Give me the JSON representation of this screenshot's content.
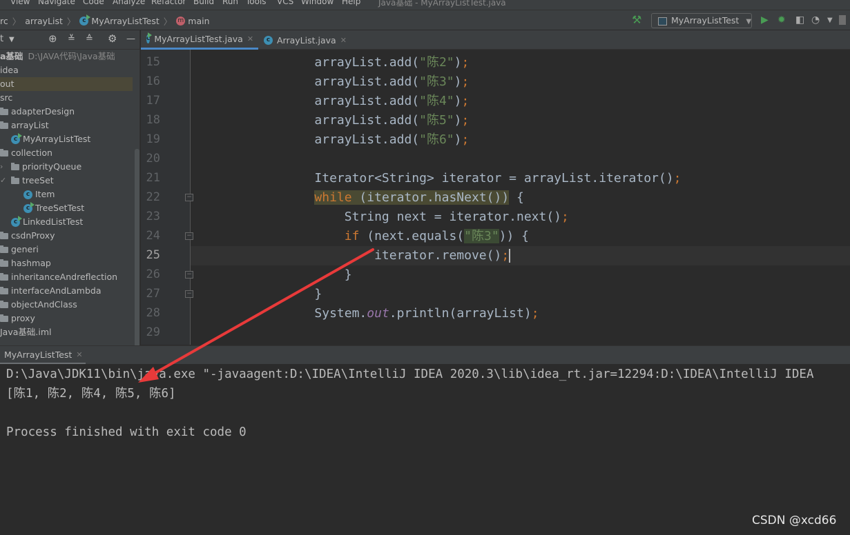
{
  "menu": {
    "items": [
      "View",
      "Navigate",
      "Code",
      "Analyze",
      "Refactor",
      "Build",
      "Run",
      "Tools",
      "VCS",
      "Window",
      "Help"
    ],
    "window_title": "Java基础 - MyArrayListTest.java"
  },
  "breadcrumb": [
    "rc",
    "arrayList",
    "MyArrayListTest",
    "main"
  ],
  "toolbar": {
    "run_config": "MyArrayListTest",
    "colors": {
      "run": "#499c54",
      "debug": "#499c54"
    }
  },
  "sidebar": {
    "header": "t",
    "items": [
      {
        "label": "a基础",
        "extra": "D:\\JAVA代码\\Java基础",
        "icon": "none",
        "level": 0
      },
      {
        "label": "idea",
        "icon": "none",
        "level": 0
      },
      {
        "label": "out",
        "icon": "none",
        "level": 0,
        "selected": true
      },
      {
        "label": "src",
        "icon": "none",
        "level": 0
      },
      {
        "label": "adapterDesign",
        "icon": "folder",
        "level": 1
      },
      {
        "label": "arrayList",
        "icon": "folder",
        "level": 1
      },
      {
        "label": "MyArrayListTest",
        "icon": "class-run",
        "level": 2
      },
      {
        "label": "collection",
        "icon": "folder",
        "level": 1
      },
      {
        "label": "priorityQueue",
        "icon": "folder",
        "level": 2,
        "arrow": "›"
      },
      {
        "label": "treeSet",
        "icon": "folder",
        "level": 2,
        "arrow": "✓"
      },
      {
        "label": "Item",
        "icon": "class",
        "level": 3
      },
      {
        "label": "TreeSetTest",
        "icon": "class-run",
        "level": 3
      },
      {
        "label": "LinkedListTest",
        "icon": "class-run",
        "level": 2
      },
      {
        "label": "csdnProxy",
        "icon": "folder",
        "level": 1
      },
      {
        "label": "generi",
        "icon": "folder",
        "level": 1
      },
      {
        "label": "hashmap",
        "icon": "folder",
        "level": 1
      },
      {
        "label": "inheritanceAndreflection",
        "icon": "folder",
        "level": 1
      },
      {
        "label": "interfaceAndLambda",
        "icon": "folder",
        "level": 1
      },
      {
        "label": "objectAndClass",
        "icon": "folder",
        "level": 1
      },
      {
        "label": "proxy",
        "icon": "folder",
        "level": 1
      },
      {
        "label": "Java基础.iml",
        "icon": "none",
        "level": 0
      }
    ]
  },
  "tabs": [
    {
      "label": "MyArrayListTest.java",
      "active": true
    },
    {
      "label": "ArrayList.java",
      "active": false
    }
  ],
  "editor": {
    "current_line": 25,
    "lines": [
      {
        "n": 15,
        "tokens": [
          [
            "        arrayList.add(",
            ""
          ],
          [
            "\"陈2\"",
            "str"
          ],
          [
            ")",
            ""
          ],
          [
            ";",
            "semi"
          ]
        ]
      },
      {
        "n": 16,
        "tokens": [
          [
            "        arrayList.add(",
            ""
          ],
          [
            "\"陈3\"",
            "str"
          ],
          [
            ")",
            ""
          ],
          [
            ";",
            "semi"
          ]
        ]
      },
      {
        "n": 17,
        "tokens": [
          [
            "        arrayList.add(",
            ""
          ],
          [
            "\"陈4\"",
            "str"
          ],
          [
            ")",
            ""
          ],
          [
            ";",
            "semi"
          ]
        ]
      },
      {
        "n": 18,
        "tokens": [
          [
            "        arrayList.add(",
            ""
          ],
          [
            "\"陈5\"",
            "str"
          ],
          [
            ")",
            ""
          ],
          [
            ";",
            "semi"
          ]
        ]
      },
      {
        "n": 19,
        "tokens": [
          [
            "        arrayList.add(",
            ""
          ],
          [
            "\"陈6\"",
            "str"
          ],
          [
            ")",
            ""
          ],
          [
            ";",
            "semi"
          ]
        ]
      },
      {
        "n": 20,
        "tokens": []
      },
      {
        "n": 21,
        "tokens": [
          [
            "        Iterator<String> iterator = arrayList.iterator()",
            ""
          ],
          [
            ";",
            "semi"
          ]
        ]
      },
      {
        "n": 22,
        "tokens": [
          [
            "        ",
            ""
          ],
          [
            "while",
            "kw hl"
          ],
          [
            " (iterator.hasNext())",
            "hl"
          ],
          [
            " {",
            ""
          ]
        ],
        "fold": true
      },
      {
        "n": 23,
        "tokens": [
          [
            "            String next = iterator.next()",
            ""
          ],
          [
            ";",
            "semi"
          ]
        ]
      },
      {
        "n": 24,
        "tokens": [
          [
            "            ",
            ""
          ],
          [
            "if",
            "kw"
          ],
          [
            " (next.equals(",
            ""
          ],
          [
            "\"陈3\"",
            "str hlg"
          ],
          [
            ")) {",
            ""
          ]
        ],
        "fold": true
      },
      {
        "n": 25,
        "tokens": [
          [
            "                iterator.remove()",
            ""
          ],
          [
            ";",
            "semi"
          ]
        ],
        "caret": true
      },
      {
        "n": 26,
        "tokens": [
          [
            "            }",
            ""
          ]
        ],
        "fold": true
      },
      {
        "n": 27,
        "tokens": [
          [
            "        }",
            ""
          ]
        ],
        "fold": true
      },
      {
        "n": 28,
        "tokens": [
          [
            "        System.",
            ""
          ],
          [
            "out",
            "fld"
          ],
          [
            ".println(arrayList)",
            ""
          ],
          [
            ";",
            "semi"
          ]
        ]
      },
      {
        "n": 29,
        "tokens": []
      }
    ]
  },
  "console": {
    "tab": "MyArrayListTest",
    "lines": [
      "D:\\Java\\JDK11\\bin\\java.exe \"-javaagent:D:\\IDEA\\IntelliJ IDEA 2020.3\\lib\\idea_rt.jar=12294:D:\\IDEA\\IntelliJ IDEA",
      "[陈1, 陈2, 陈4, 陈5, 陈6]",
      "",
      "Process finished with exit code 0"
    ]
  },
  "watermark": "CSDN @xcd66",
  "annotation_color": "#e83a3a"
}
